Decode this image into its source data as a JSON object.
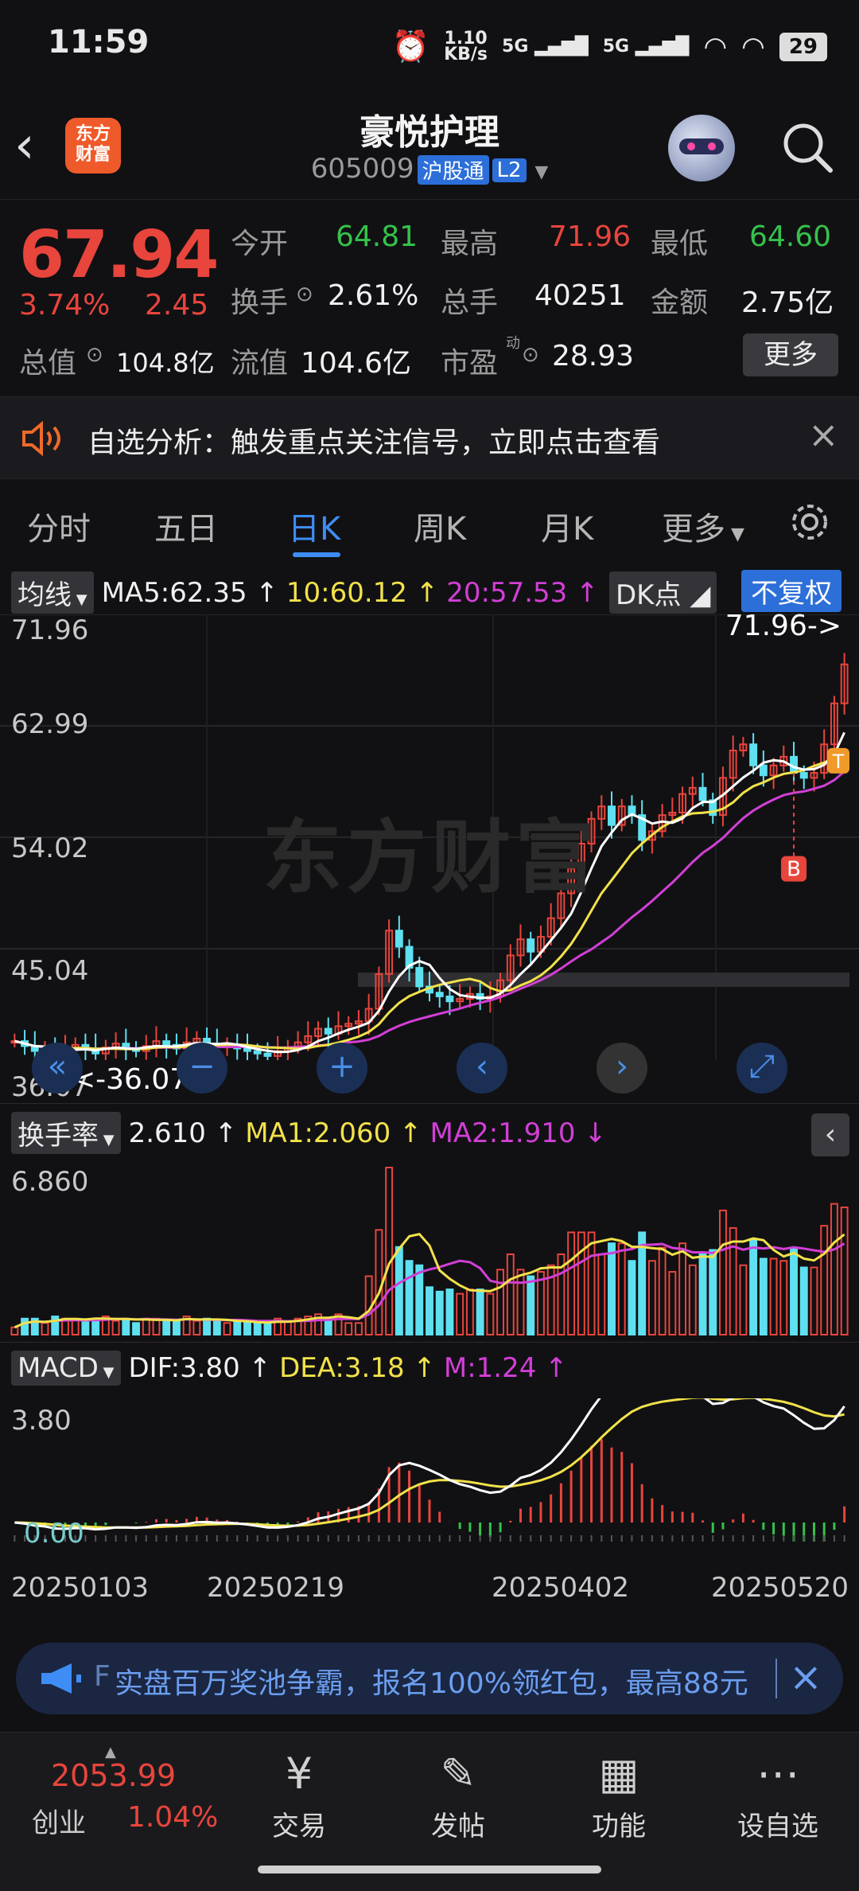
{
  "status_bar": {
    "time": "11:59",
    "net_speed_top": "1.10",
    "net_speed_bottom": "KB/s",
    "sig1": "5G",
    "sig2": "5G",
    "battery": "29"
  },
  "header": {
    "title": "豪悦护理",
    "code": "605009",
    "tag1": "沪股通",
    "tag2": "L2",
    "logo_line1": "东方",
    "logo_line2": "财富"
  },
  "quote": {
    "price": "67.94",
    "change_pct": "3.74%",
    "change": "2.45",
    "open_label": "今开",
    "open": "64.81",
    "high_label": "最高",
    "high": "71.96",
    "low_label": "最低",
    "low": "64.60",
    "turnover_label": "换手",
    "turnover": "2.61%",
    "volume_label": "总手",
    "volume": "40251",
    "amount_label": "金额",
    "amount": "2.75亿",
    "mktcap_label": "总值",
    "mktcap": "104.8亿",
    "float_label": "流值",
    "float_cap": "104.6亿",
    "pe_label": "市盈",
    "pe_sup": "动",
    "pe": "28.93",
    "more": "更多"
  },
  "alert": {
    "text": "自选分析：触发重点关注信号，立即点击查看"
  },
  "tabs": [
    "分时",
    "五日",
    "日K",
    "周K",
    "月K",
    "更多"
  ],
  "active_tab": "日K",
  "kline": {
    "selector": "均线",
    "ma5": "MA5:62.35",
    "ma10": "10:60.12",
    "ma20": "20:57.53",
    "dk_label": "DK点",
    "adj_label": "不复权",
    "y_ticks": [
      "71.96",
      "62.99",
      "54.02",
      "45.04",
      "36.07"
    ],
    "max_marker": "71.96->",
    "min_marker": "36.07",
    "b_marker": "B",
    "t_marker": "T",
    "watermark": "东方财富"
  },
  "turnover_panel": {
    "selector": "换手率",
    "value": "2.610",
    "ma1": "MA1:2.060",
    "ma2": "MA2:1.910",
    "y_max": "6.860"
  },
  "macd_panel": {
    "selector": "MACD",
    "dif": "DIF:3.80",
    "dea": "DEA:3.18",
    "m": "M:1.24",
    "y_max": "3.80",
    "y_zero": "0.00"
  },
  "dates": [
    "20250103",
    "20250219",
    "20250402",
    "20250520"
  ],
  "ad": {
    "text": "实盘百万奖池争霸，报名100%领红包，最高88元",
    "prefix": "F"
  },
  "bottom": {
    "index_value": "2053.99",
    "index_name": "创业",
    "index_change": "1.04%",
    "nav": [
      {
        "icon": "¥",
        "label": "交易"
      },
      {
        "icon": "✎",
        "label": "发帖"
      },
      {
        "icon": "▦",
        "label": "功能"
      },
      {
        "icon": "⋯",
        "label": "设自选"
      }
    ]
  },
  "chart_data": {
    "type": "candlestick",
    "title": "",
    "close": [
      37.6,
      37.2,
      36.8,
      37.0,
      36.5,
      36.9,
      37.3,
      37.0,
      36.6,
      37.1,
      37.4,
      37.0,
      36.8,
      37.2,
      37.6,
      37.3,
      37.0,
      37.5,
      37.8,
      37.4,
      37.1,
      37.3,
      37.0,
      36.8,
      36.6,
      36.4,
      36.8,
      37.1,
      37.5,
      38.0,
      38.6,
      38.2,
      38.8,
      39.0,
      39.2,
      40.2,
      43.0,
      46.5,
      45.2,
      43.5,
      42.0,
      41.5,
      41.2,
      40.8,
      41.0,
      41.4,
      41.0,
      41.2,
      42.5,
      44.5,
      45.8,
      44.8,
      46.0,
      47.5,
      49.5,
      51.5,
      53.5,
      55.5,
      56.5,
      55.0,
      56.5,
      55.8,
      53.8,
      54.5,
      55.8,
      56.0,
      57.5,
      58.0,
      57.0,
      55.8,
      58.8,
      61.0,
      61.5,
      59.8,
      59.0,
      59.8,
      60.5,
      59.2,
      58.8,
      59.2,
      61.5,
      64.8,
      67.94
    ],
    "ma5_last": 62.35,
    "ma10_last": 60.12,
    "ma20_last": 57.53,
    "ylim": [
      36.07,
      71.96
    ],
    "turnover_last": 2.61,
    "turnover_ma1": 2.06,
    "turnover_ma2": 1.91,
    "turnover_max": 6.86,
    "macd_dif": 3.8,
    "macd_dea": 3.18,
    "macd_m": 1.24
  }
}
